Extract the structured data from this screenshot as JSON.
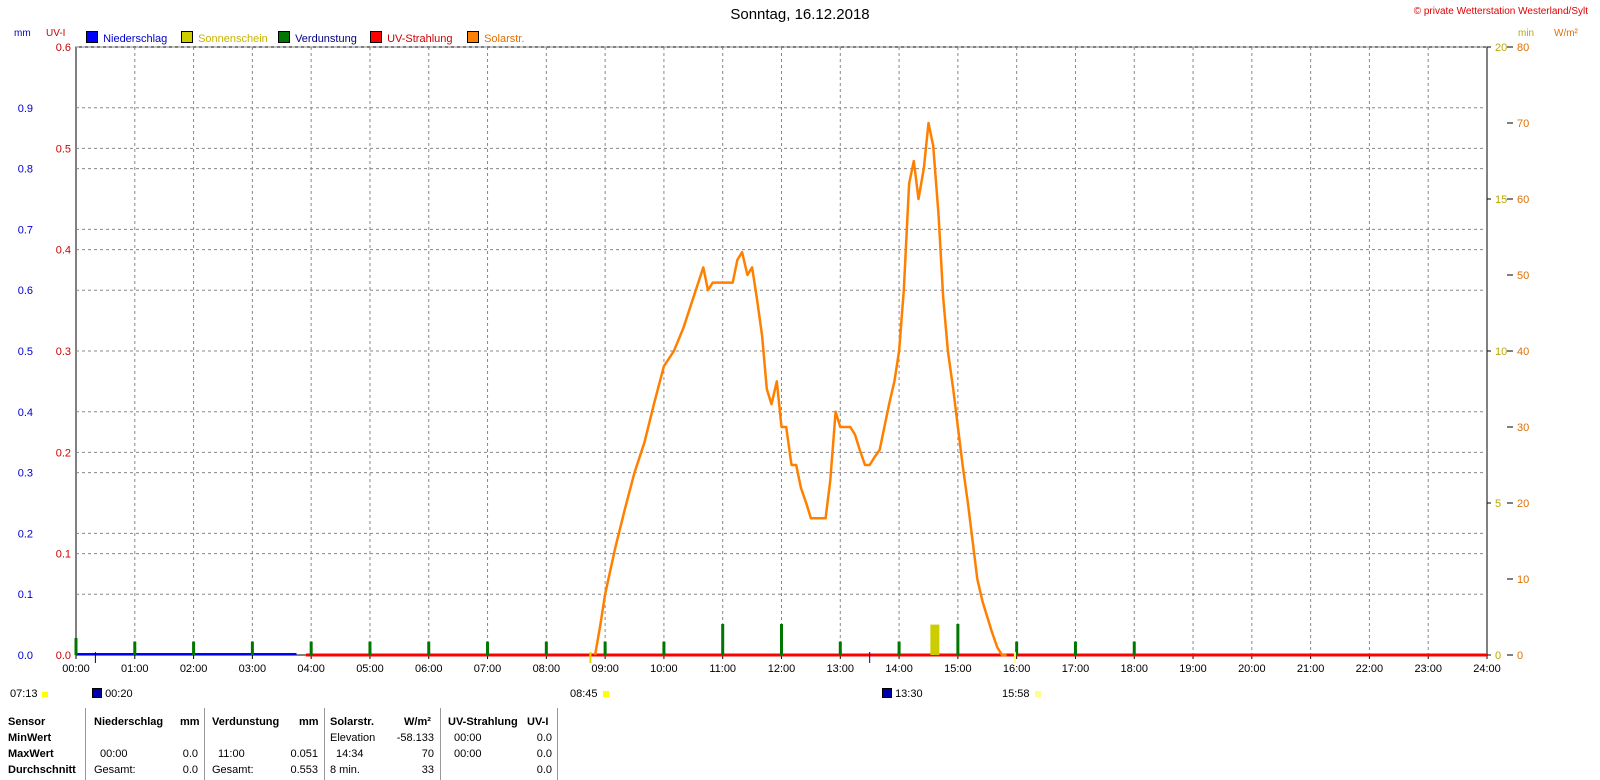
{
  "header": {
    "title": "Sonntag, 16.12.2018",
    "copyright": "© private Wetterstation Westerland/Sylt",
    "unit_mm": "mm",
    "unit_uvi": "UV-I",
    "unit_min": "min",
    "unit_wm2": "W/m²"
  },
  "legend": [
    {
      "label": "Niederschlag",
      "color": "#0000ff",
      "text_color": "#0000cc"
    },
    {
      "label": "Sonnenschein",
      "color": "#cccc00",
      "text_color": "#c8b400"
    },
    {
      "label": "Verdunstung",
      "color": "#007700",
      "text_color": "#000080"
    },
    {
      "label": "UV-Strahlung",
      "color": "#ff0000",
      "text_color": "#cc0000"
    },
    {
      "label": "Solarstr.",
      "color": "#ff8000",
      "text_color": "#e07000"
    }
  ],
  "chart_data": {
    "type": "line",
    "x_range": [
      "00:00",
      "24:00"
    ],
    "x_ticks": [
      "00:00",
      "01:00",
      "02:00",
      "03:00",
      "04:00",
      "05:00",
      "06:00",
      "07:00",
      "08:00",
      "09:00",
      "10:00",
      "11:00",
      "12:00",
      "13:00",
      "14:00",
      "15:00",
      "16:00",
      "17:00",
      "18:00",
      "19:00",
      "20:00",
      "21:00",
      "22:00",
      "23:00",
      "24:00"
    ],
    "axes": {
      "mm": {
        "range": [
          0,
          1.0
        ],
        "ticks": [
          "0.0",
          "0.1",
          "0.2",
          "0.3",
          "0.4",
          "0.5",
          "0.6",
          "0.7",
          "0.8",
          "0.9"
        ],
        "color": "#0000cc"
      },
      "uvi": {
        "range": [
          0,
          0.6
        ],
        "ticks": [
          "0.0",
          "0.1",
          "0.2",
          "0.3",
          "0.4",
          "0.5",
          "0.6"
        ],
        "color": "#cc0000"
      },
      "min": {
        "range": [
          0,
          20
        ],
        "ticks": [
          "0",
          "5",
          "10",
          "15",
          "20"
        ],
        "color": "#b8a800"
      },
      "wm2": {
        "range": [
          0,
          80
        ],
        "ticks": [
          "0",
          "10",
          "20",
          "30",
          "40",
          "50",
          "60",
          "70",
          "80"
        ],
        "color": "#e07000"
      }
    },
    "grid": true,
    "series": [
      {
        "name": "Solarstr.",
        "axis": "wm2",
        "color": "#ff8000",
        "x": [
          8.83,
          8.92,
          9.0,
          9.17,
          9.33,
          9.5,
          9.67,
          9.83,
          10.0,
          10.17,
          10.33,
          10.5,
          10.67,
          10.75,
          10.83,
          11.0,
          11.17,
          11.25,
          11.33,
          11.42,
          11.5,
          11.58,
          11.67,
          11.75,
          11.83,
          11.92,
          12.0,
          12.08,
          12.17,
          12.25,
          12.33,
          12.42,
          12.5,
          12.58,
          12.67,
          12.75,
          12.83,
          12.92,
          13.0,
          13.08,
          13.17,
          13.25,
          13.33,
          13.42,
          13.5,
          13.58,
          13.67,
          13.75,
          13.83,
          13.92,
          14.0,
          14.08,
          14.17,
          14.25,
          14.33,
          14.42,
          14.5,
          14.58,
          14.67,
          14.75,
          14.83,
          14.92,
          15.0,
          15.08,
          15.17,
          15.25,
          15.33,
          15.42,
          15.5,
          15.58,
          15.67,
          15.75,
          15.83
        ],
        "values": [
          0,
          4,
          8,
          14,
          19,
          24,
          28,
          33,
          38,
          40,
          43,
          47,
          51,
          48,
          49,
          49,
          49,
          52,
          53,
          50,
          51,
          47,
          42,
          35,
          33,
          36,
          30,
          30,
          25,
          25,
          22,
          20,
          18,
          18,
          18,
          18,
          23,
          32,
          30,
          30,
          30,
          29,
          27,
          25,
          25,
          26,
          27,
          30,
          33,
          36,
          40,
          48,
          62,
          65,
          60,
          64,
          70,
          67,
          58,
          47,
          40,
          35,
          30,
          25,
          20,
          15,
          10,
          7,
          5,
          3,
          1,
          0,
          0
        ]
      },
      {
        "name": "Sonnenschein",
        "axis": "min",
        "color": "#cccc00",
        "x": [
          14.6
        ],
        "values": [
          1
        ]
      },
      {
        "name": "Verdunstung",
        "axis": "mm",
        "color": "#007700",
        "x": [
          0,
          1,
          2,
          3,
          4,
          5,
          6,
          7,
          8,
          9,
          10,
          11,
          12,
          13,
          14,
          15,
          16,
          17,
          18
        ],
        "values": [
          0.028,
          0.022,
          0.022,
          0.022,
          0.022,
          0.022,
          0.022,
          0.022,
          0.022,
          0.022,
          0.022,
          0.051,
          0.051,
          0.022,
          0.022,
          0.051,
          0.022,
          0.022,
          0.022
        ]
      },
      {
        "name": "UV-Strahlung",
        "axis": "uvi",
        "color": "#ff0000",
        "x": [
          0,
          24
        ],
        "values": [
          0.0,
          0.0
        ]
      },
      {
        "name": "Niederschlag",
        "axis": "mm",
        "color": "#0000ff",
        "x": [
          0,
          3.75
        ],
        "values": [
          0.0,
          0.0
        ]
      }
    ]
  },
  "markers": {
    "left_time": "07:13",
    "moonrise_time": "00:20",
    "sunrise": "08:45",
    "moonset_time": "13:30",
    "sunset": "15:58"
  },
  "stats": {
    "sensor_label": "Sensor",
    "row_labels": [
      "MinWert",
      "MaxWert",
      "Durchschnitt"
    ],
    "niederschlag": {
      "header": "Niederschlag",
      "unit": "mm",
      "max_time": "00:00",
      "max_val": "0.0",
      "sum_label": "Gesamt:",
      "sum_val": "0.0"
    },
    "verdunstung": {
      "header": "Verdunstung",
      "unit": "mm",
      "max_time": "11:00",
      "max_val": "0.051",
      "sum_label": "Gesamt:",
      "sum_val": "0.553"
    },
    "solar": {
      "header": "Solarstr.",
      "unit": "W/m²",
      "min_label": "Elevation",
      "min_val": "-58.133",
      "max_time": "14:34",
      "max_val": "70",
      "avg_label": "8 min.",
      "avg_val": "33"
    },
    "uv": {
      "header": "UV-Strahlung",
      "unit": "UV-I",
      "min_time": "00:00",
      "min_val": "0.0",
      "max_time": "00:00",
      "max_val": "0.0",
      "avg_val": "0.0"
    }
  }
}
